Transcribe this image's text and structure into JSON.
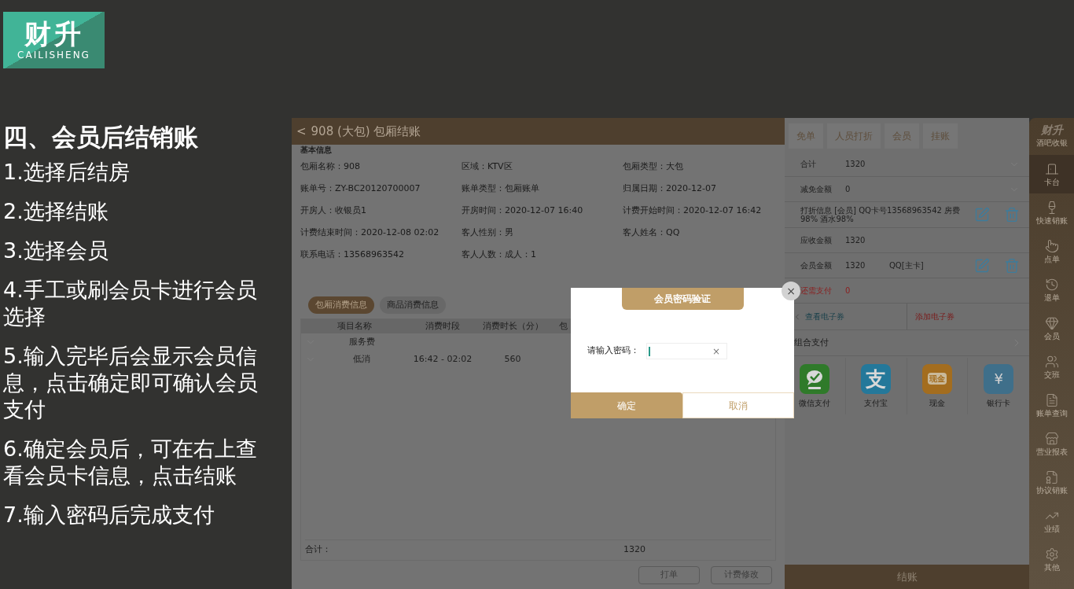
{
  "logo": {
    "name": "财升",
    "latin": "CAILISHENG"
  },
  "slide": {
    "title": "四、会员后结销账",
    "steps": [
      "1.选择后结房",
      "2.选择结账",
      "3.选择会员",
      "4.手工或刷会员卡进行会员选择",
      "5.输入完毕后会显示会员信息，点击确定即可确认会员支付",
      "6.确定会员后，可在右上查看会员卡信息，点击结账",
      "7.输入密码后完成支付"
    ]
  },
  "app": {
    "header": {
      "back": "<",
      "title": "908 (大包) 包厢结账"
    },
    "basic_info": {
      "heading": "基本信息",
      "fields": [
        {
          "label": "包厢名称：",
          "value": "908"
        },
        {
          "label": "区域：",
          "value": "KTV区"
        },
        {
          "label": "包厢类型：",
          "value": "大包"
        },
        {
          "label": "账单号：",
          "value": "ZY-BC20120700007"
        },
        {
          "label": "账单类型：",
          "value": "包厢账单"
        },
        {
          "label": "归属日期：",
          "value": "2020-12-07"
        },
        {
          "label": "开房人：",
          "value": "收银员1"
        },
        {
          "label": "开房时间：",
          "value": "2020-12-07 16:40"
        },
        {
          "label": "计费开始时间：",
          "value": "2020-12-07 16:42"
        },
        {
          "label": "计费结束时间：",
          "value": "2020-12-08 02:02"
        },
        {
          "label": "客人性别：",
          "value": "男"
        },
        {
          "label": "客人姓名：",
          "value": "QQ"
        },
        {
          "label": "联系电话：",
          "value": "13568963542"
        },
        {
          "label": "客人人数：",
          "value": "成人：1"
        }
      ]
    },
    "tabs": [
      {
        "label": "包厢消费信息",
        "selected": true
      },
      {
        "label": "商品消费信息",
        "selected": false
      }
    ],
    "table": {
      "columns": [
        "项目名称",
        "消费时段",
        "消费时长（分）",
        "包"
      ],
      "rows": [
        {
          "expanded": false,
          "cells": [
            "服务费",
            "",
            ""
          ]
        },
        {
          "expanded": false,
          "cells": [
            "低消",
            "16:42 - 02:02",
            "560"
          ]
        }
      ],
      "total": {
        "label": "合计：",
        "value": "1320"
      }
    },
    "bottom_buttons": [
      "打单",
      "计费修改"
    ],
    "actions": [
      "免单",
      "人员打折",
      "会员",
      "挂账"
    ],
    "summary": [
      {
        "kind": "dropdown",
        "label": "合计",
        "value": "1320"
      },
      {
        "kind": "dropdown",
        "label": "减免金额",
        "value": "0"
      },
      {
        "kind": "editable",
        "label": "打折信息",
        "value": "[会员] QQ卡号13568963542 房费98% 酒水98%"
      },
      {
        "kind": "plain",
        "label": "应收金额",
        "value": "1320"
      },
      {
        "kind": "editable",
        "label": "会员金额",
        "value": "1320",
        "extra": "QQ[主卡]"
      },
      {
        "kind": "due",
        "label": "还需支付",
        "value": "0"
      }
    ],
    "coupons": {
      "view": "查看电子券",
      "add": "添加电子券"
    },
    "combo": "组合支付",
    "payments": [
      {
        "kind": "wechat",
        "label": "微信支付"
      },
      {
        "kind": "alipay",
        "label": "支付宝",
        "icon_text": "支"
      },
      {
        "kind": "cash",
        "label": "现金",
        "icon_text": "现金"
      },
      {
        "kind": "bank",
        "label": "银行卡",
        "icon_text": "¥"
      }
    ],
    "checkout": "结账",
    "sidebar": {
      "brand": "财升",
      "subtitle": "酒吧收银",
      "items": [
        {
          "label": "卡台",
          "selected": true
        },
        {
          "label": "快速销账",
          "selected": false
        },
        {
          "label": "点单",
          "selected": false
        },
        {
          "label": "退单",
          "selected": false
        },
        {
          "label": "会员",
          "selected": false
        },
        {
          "label": "交班",
          "selected": false
        },
        {
          "label": "账单查询",
          "selected": false
        },
        {
          "label": "营业报表",
          "selected": false
        },
        {
          "label": "协议销账",
          "selected": false
        },
        {
          "label": "业绩",
          "selected": false
        },
        {
          "label": "其他",
          "selected": false
        }
      ]
    },
    "dialog": {
      "title": "会员密码验证",
      "close": "×",
      "field_label": "请输入密码：",
      "clear": "×",
      "confirm": "确定",
      "cancel": "取消"
    }
  }
}
